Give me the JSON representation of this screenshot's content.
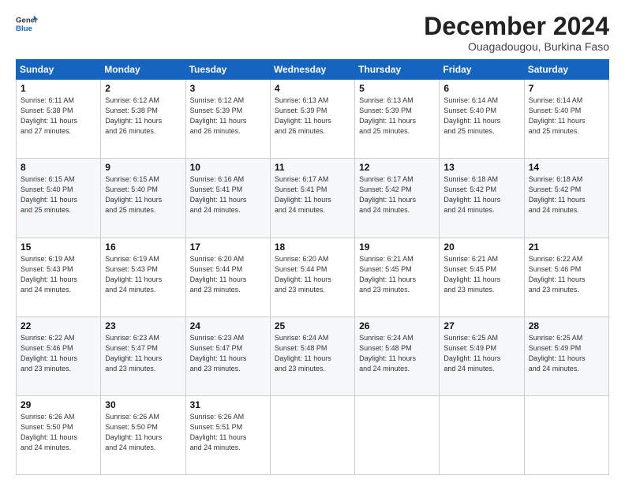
{
  "logo": {
    "line1": "General",
    "line2": "Blue"
  },
  "title": "December 2024",
  "location": "Ouagadougouu, Burkina Faso",
  "headers": [
    "Sunday",
    "Monday",
    "Tuesday",
    "Wednesday",
    "Thursday",
    "Friday",
    "Saturday"
  ],
  "weeks": [
    [
      {
        "day": "1",
        "info": "Sunrise: 6:11 AM\nSunset: 5:38 PM\nDaylight: 11 hours\nand 27 minutes."
      },
      {
        "day": "2",
        "info": "Sunrise: 6:12 AM\nSunset: 5:38 PM\nDaylight: 11 hours\nand 26 minutes."
      },
      {
        "day": "3",
        "info": "Sunrise: 6:12 AM\nSunset: 5:39 PM\nDaylight: 11 hours\nand 26 minutes."
      },
      {
        "day": "4",
        "info": "Sunrise: 6:13 AM\nSunset: 5:39 PM\nDaylight: 11 hours\nand 26 minutes."
      },
      {
        "day": "5",
        "info": "Sunrise: 6:13 AM\nSunset: 5:39 PM\nDaylight: 11 hours\nand 25 minutes."
      },
      {
        "day": "6",
        "info": "Sunrise: 6:14 AM\nSunset: 5:40 PM\nDaylight: 11 hours\nand 25 minutes."
      },
      {
        "day": "7",
        "info": "Sunrise: 6:14 AM\nSunset: 5:40 PM\nDaylight: 11 hours\nand 25 minutes."
      }
    ],
    [
      {
        "day": "8",
        "info": "Sunrise: 6:15 AM\nSunset: 5:40 PM\nDaylight: 11 hours\nand 25 minutes."
      },
      {
        "day": "9",
        "info": "Sunrise: 6:15 AM\nSunset: 5:40 PM\nDaylight: 11 hours\nand 25 minutes."
      },
      {
        "day": "10",
        "info": "Sunrise: 6:16 AM\nSunset: 5:41 PM\nDaylight: 11 hours\nand 24 minutes."
      },
      {
        "day": "11",
        "info": "Sunrise: 6:17 AM\nSunset: 5:41 PM\nDaylight: 11 hours\nand 24 minutes."
      },
      {
        "day": "12",
        "info": "Sunrise: 6:17 AM\nSunset: 5:42 PM\nDaylight: 11 hours\nand 24 minutes."
      },
      {
        "day": "13",
        "info": "Sunrise: 6:18 AM\nSunset: 5:42 PM\nDaylight: 11 hours\nand 24 minutes."
      },
      {
        "day": "14",
        "info": "Sunrise: 6:18 AM\nSunset: 5:42 PM\nDaylight: 11 hours\nand 24 minutes."
      }
    ],
    [
      {
        "day": "15",
        "info": "Sunrise: 6:19 AM\nSunset: 5:43 PM\nDaylight: 11 hours\nand 24 minutes."
      },
      {
        "day": "16",
        "info": "Sunrise: 6:19 AM\nSunset: 5:43 PM\nDaylight: 11 hours\nand 24 minutes."
      },
      {
        "day": "17",
        "info": "Sunrise: 6:20 AM\nSunset: 5:44 PM\nDaylight: 11 hours\nand 23 minutes."
      },
      {
        "day": "18",
        "info": "Sunrise: 6:20 AM\nSunset: 5:44 PM\nDaylight: 11 hours\nand 23 minutes."
      },
      {
        "day": "19",
        "info": "Sunrise: 6:21 AM\nSunset: 5:45 PM\nDaylight: 11 hours\nand 23 minutes."
      },
      {
        "day": "20",
        "info": "Sunrise: 6:21 AM\nSunset: 5:45 PM\nDaylight: 11 hours\nand 23 minutes."
      },
      {
        "day": "21",
        "info": "Sunrise: 6:22 AM\nSunset: 5:46 PM\nDaylight: 11 hours\nand 23 minutes."
      }
    ],
    [
      {
        "day": "22",
        "info": "Sunrise: 6:22 AM\nSunset: 5:46 PM\nDaylight: 11 hours\nand 23 minutes."
      },
      {
        "day": "23",
        "info": "Sunrise: 6:23 AM\nSunset: 5:47 PM\nDaylight: 11 hours\nand 23 minutes."
      },
      {
        "day": "24",
        "info": "Sunrise: 6:23 AM\nSunset: 5:47 PM\nDaylight: 11 hours\nand 23 minutes."
      },
      {
        "day": "25",
        "info": "Sunrise: 6:24 AM\nSunset: 5:48 PM\nDaylight: 11 hours\nand 23 minutes."
      },
      {
        "day": "26",
        "info": "Sunrise: 6:24 AM\nSunset: 5:48 PM\nDaylight: 11 hours\nand 24 minutes."
      },
      {
        "day": "27",
        "info": "Sunrise: 6:25 AM\nSunset: 5:49 PM\nDaylight: 11 hours\nand 24 minutes."
      },
      {
        "day": "28",
        "info": "Sunrise: 6:25 AM\nSunset: 5:49 PM\nDaylight: 11 hours\nand 24 minutes."
      }
    ],
    [
      {
        "day": "29",
        "info": "Sunrise: 6:26 AM\nSunset: 5:50 PM\nDaylight: 11 hours\nand 24 minutes."
      },
      {
        "day": "30",
        "info": "Sunrise: 6:26 AM\nSunset: 5:50 PM\nDaylight: 11 hours\nand 24 minutes."
      },
      {
        "day": "31",
        "info": "Sunrise: 6:26 AM\nSunset: 5:51 PM\nDaylight: 11 hours\nand 24 minutes."
      },
      {
        "day": "",
        "info": ""
      },
      {
        "day": "",
        "info": ""
      },
      {
        "day": "",
        "info": ""
      },
      {
        "day": "",
        "info": ""
      }
    ]
  ]
}
